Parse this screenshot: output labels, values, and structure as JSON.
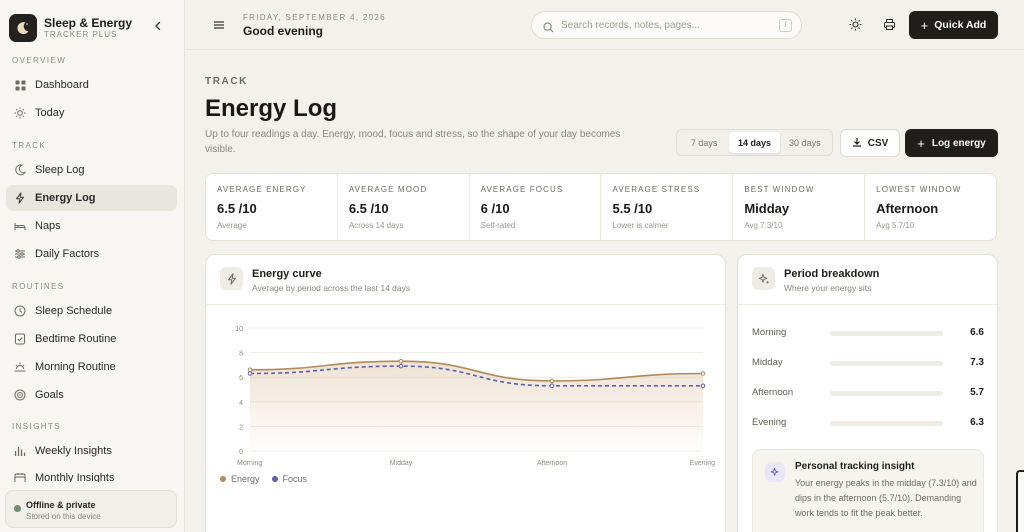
{
  "brand": {
    "title": "Sleep & Energy",
    "subtitle": "TRACKER PLUS"
  },
  "sidebar": {
    "sections": [
      {
        "label": "OVERVIEW",
        "items": [
          {
            "label": "Dashboard",
            "icon": "grid-icon"
          },
          {
            "label": "Today",
            "icon": "sun-icon"
          }
        ]
      },
      {
        "label": "TRACK",
        "items": [
          {
            "label": "Sleep Log",
            "icon": "moon-icon"
          },
          {
            "label": "Energy Log",
            "icon": "bolt-icon",
            "active": true
          },
          {
            "label": "Naps",
            "icon": "bed-icon"
          },
          {
            "label": "Daily Factors",
            "icon": "sliders-icon"
          }
        ]
      },
      {
        "label": "ROUTINES",
        "items": [
          {
            "label": "Sleep Schedule",
            "icon": "clock-icon"
          },
          {
            "label": "Bedtime Routine",
            "icon": "checklist-icon"
          },
          {
            "label": "Morning Routine",
            "icon": "sunrise-icon"
          },
          {
            "label": "Goals",
            "icon": "target-icon"
          }
        ]
      },
      {
        "label": "INSIGHTS",
        "items": [
          {
            "label": "Weekly Insights",
            "icon": "bar-chart-icon"
          },
          {
            "label": "Monthly Insights",
            "icon": "calendar-icon"
          }
        ]
      }
    ],
    "status": {
      "title": "Offline & private",
      "subtitle": "Stored on this device"
    }
  },
  "header": {
    "date": "FRIDAY, SEPTEMBER 4, 2026",
    "greeting": "Good evening",
    "search_placeholder": "Search records, notes, pages...",
    "search_shortcut": "/",
    "quick_add": "Quick Add"
  },
  "page": {
    "eyebrow": "TRACK",
    "title": "Energy Log",
    "description": "Up to four readings a day. Energy, mood, focus and stress, so the shape of your day becomes visible.",
    "ranges": [
      "7 days",
      "14 days",
      "30 days"
    ],
    "active_range": "14 days",
    "csv_label": "CSV",
    "log_label": "Log energy"
  },
  "stats": [
    {
      "label": "AVERAGE ENERGY",
      "value": "6.5 /10",
      "sub": "Average"
    },
    {
      "label": "AVERAGE MOOD",
      "value": "6.5 /10",
      "sub": "Across 14 days"
    },
    {
      "label": "AVERAGE FOCUS",
      "value": "6 /10",
      "sub": "Self-rated"
    },
    {
      "label": "AVERAGE STRESS",
      "value": "5.5 /10",
      "sub": "Lower is calmer"
    },
    {
      "label": "BEST WINDOW",
      "value": "Midday",
      "sub": "Avg 7.3/10"
    },
    {
      "label": "LOWEST WINDOW",
      "value": "Afternoon",
      "sub": "Avg 5.7/10"
    }
  ],
  "energy_curve": {
    "title": "Energy curve",
    "subtitle": "Average by period across the last 14 days"
  },
  "chart_data": {
    "type": "line",
    "categories": [
      "Morning",
      "Midday",
      "Afternoon",
      "Evening"
    ],
    "series": [
      {
        "name": "Energy",
        "values": [
          6.6,
          7.3,
          5.7,
          6.3
        ],
        "color": "#b08a5a"
      },
      {
        "name": "Focus",
        "values": [
          6.3,
          6.9,
          5.3,
          5.3
        ],
        "color": "#5d5fae"
      }
    ],
    "ylim": [
      0,
      10
    ],
    "yticks": [
      "0",
      "2",
      "4",
      "6",
      "8",
      "10"
    ],
    "grid": true,
    "legend": "bottom-left"
  },
  "period_breakdown": {
    "title": "Period breakdown",
    "subtitle": "Where your energy sits",
    "rows": [
      {
        "label": "Morning",
        "value": "6.6"
      },
      {
        "label": "Midday",
        "value": "7.3"
      },
      {
        "label": "Afternoon",
        "value": "5.7"
      },
      {
        "label": "Evening",
        "value": "6.3"
      }
    ]
  },
  "insight": {
    "title": "Personal tracking insight",
    "body": "Your energy peaks in the midday (7.3/10) and dips in the afternoon (5.7/10). Demanding work tends to fit the peak better."
  }
}
